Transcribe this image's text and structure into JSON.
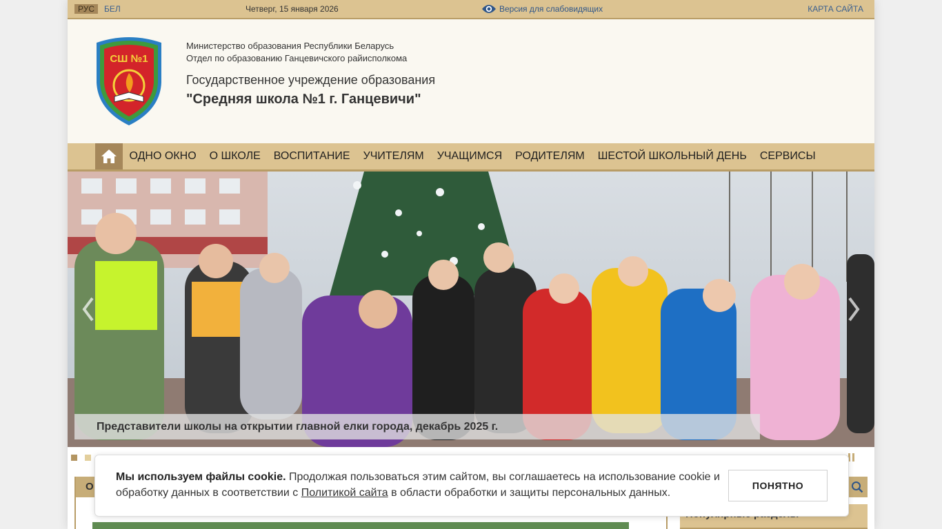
{
  "topbar": {
    "lang_ru": "РУС",
    "lang_by": "БЕЛ",
    "date": "Четверг, 15 января 2026",
    "low_vision": "Версия для слабовидящих",
    "sitemap": "КАРТА САЙТА"
  },
  "header": {
    "emblem_text": "СШ №1",
    "ministry_line1": "Министерство образования Республики Беларусь",
    "ministry_line2": "Отдел по образованию Ганцевичского райисполкома",
    "institution": "Государственное учреждение образования",
    "school_name": "\"Средняя школа №1 г. Ганцевичи\""
  },
  "nav": {
    "home_icon": "home-icon",
    "items": [
      "ОДНО ОКНО",
      "О ШКОЛЕ",
      "ВОСПИТАНИЕ",
      "УЧИТЕЛЯМ",
      "УЧАЩИМСЯ",
      "РОДИТЕЛЯМ",
      "ШЕСТОЙ ШКОЛЬНЫЙ ДЕНЬ",
      "СЕРВИСЫ"
    ]
  },
  "slider": {
    "caption": "Представители школы на открытии главной елки города, декабрь 2025 г.",
    "slide_count": 16,
    "active_slide": 1
  },
  "content": {
    "main_tab_label": "О",
    "popular_title": "Популярные разделы"
  },
  "cookie": {
    "bold": "Мы используем файлы cookie.",
    "text_before_link": " Продолжая пользоваться этим сайтом, вы соглашаетесь на использование cookie и обработку данных в соответствии с ",
    "link_text": "Политикой сайта",
    "text_after_link": " в области обработки и защиты персональных данных.",
    "button": "ПОНЯТНО"
  },
  "colors": {
    "topbar": "#dcc391",
    "accent_dark": "#a5875a",
    "link": "#3a5f8f"
  }
}
